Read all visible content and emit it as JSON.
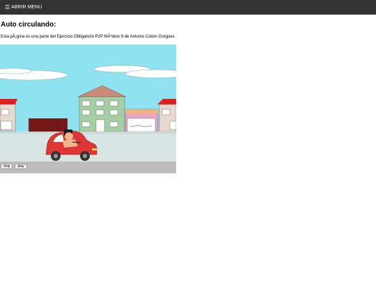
{
  "topbar": {
    "menu_icon": "hamburger-icon",
    "menu_glyph": "☰",
    "menu_label": "ABRIR MENU",
    "bg_color": "#333333"
  },
  "main": {
    "title": "Auto circulando:",
    "description": "Esta pÃ¡gina es una parte del Ejercicio Obligatorio P2P MÃ³dulo 9 de Antonio Colom Gorgues"
  },
  "animation": {
    "colors": {
      "sky": "#8fe3f0",
      "road": "#bdbdbd",
      "sidewalk": "#d9e4e4",
      "car": "#e03535"
    },
    "controls": {
      "stop_label": "stop",
      "play_label": "play"
    }
  }
}
